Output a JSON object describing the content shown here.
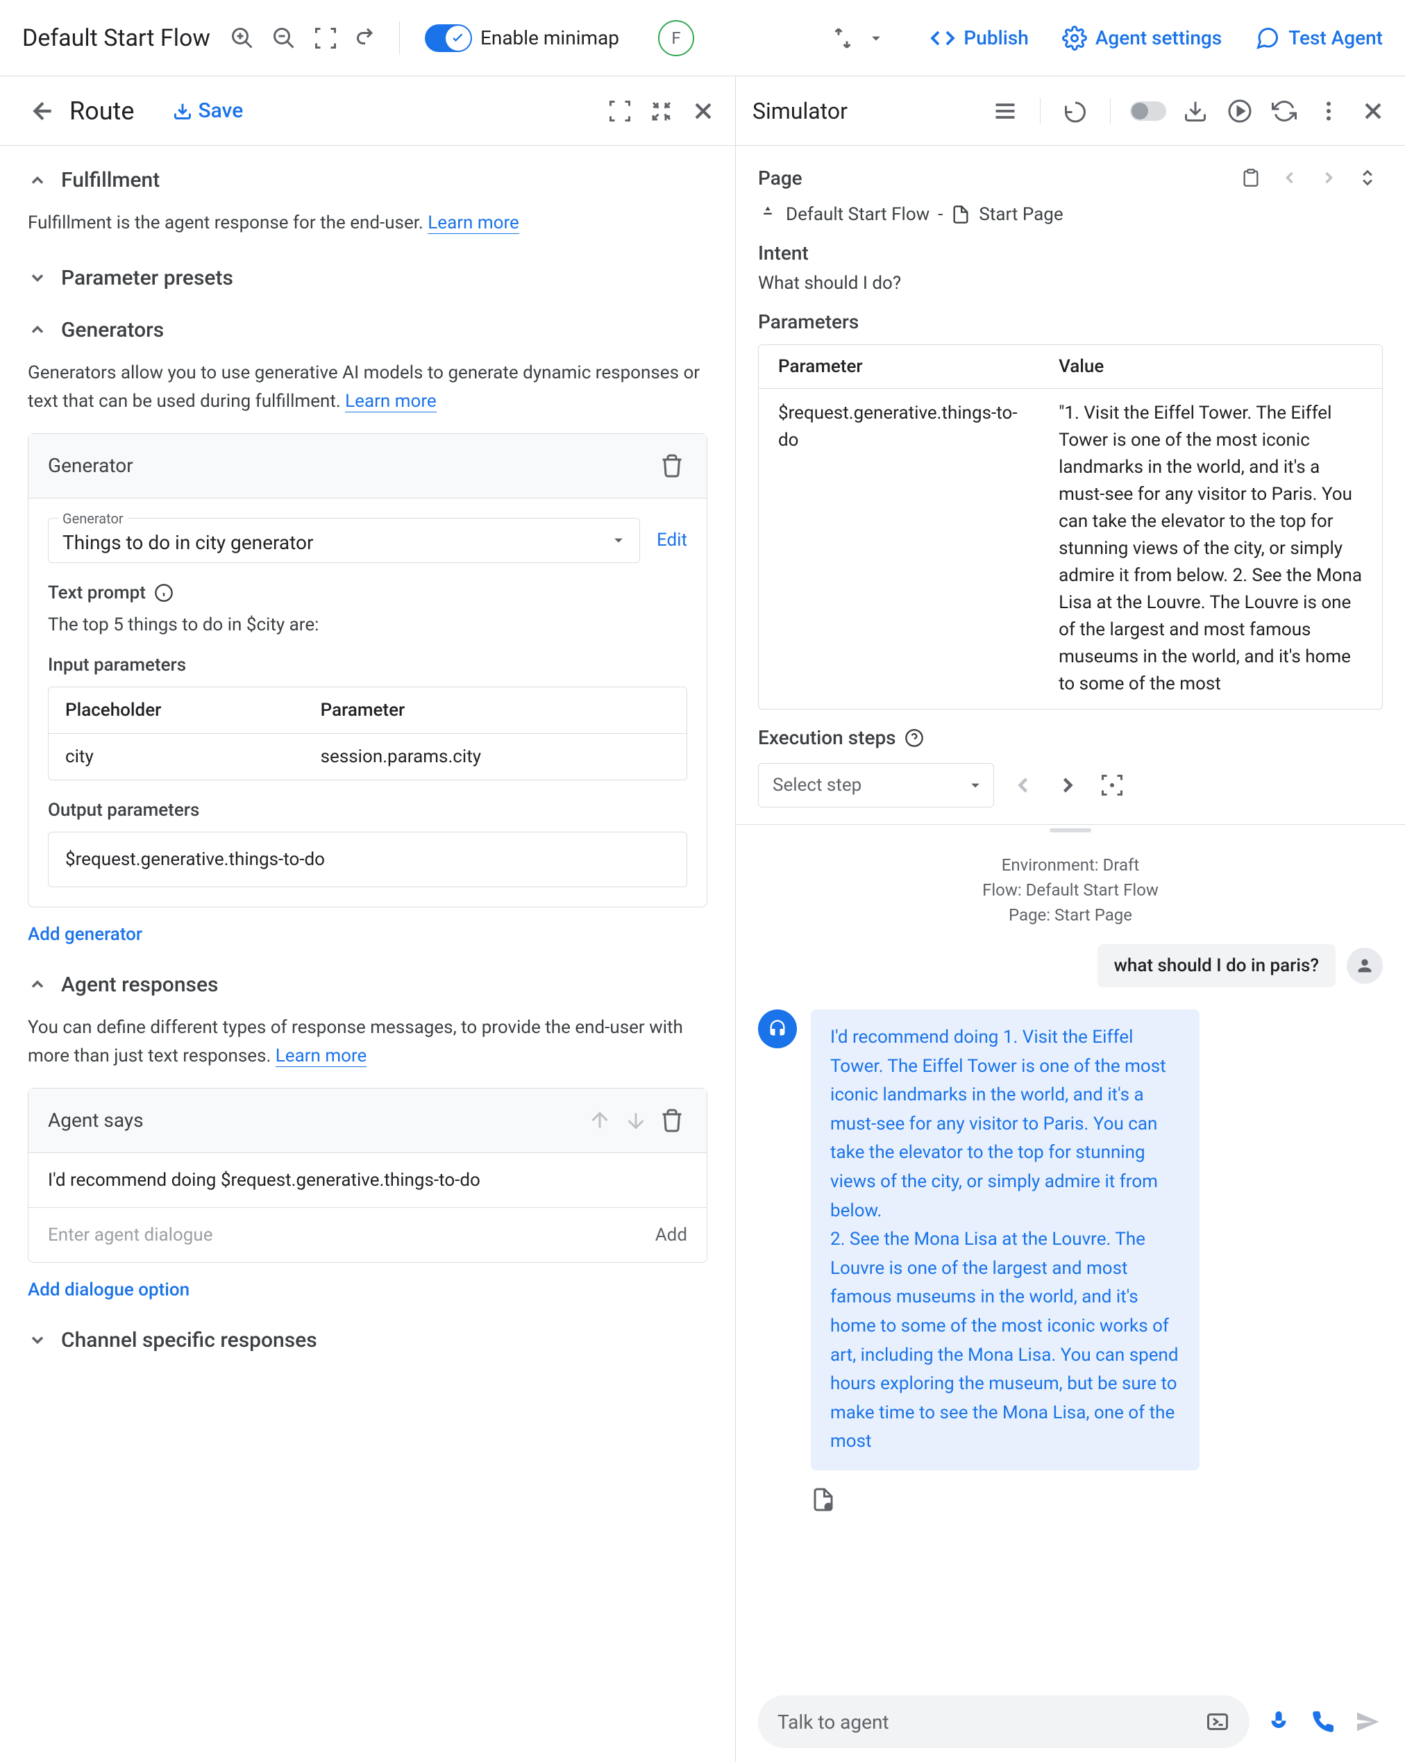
{
  "topbar": {
    "flow_title": "Default Start Flow",
    "minimap_label": "Enable minimap",
    "avatar_letter": "F",
    "publish": "Publish",
    "agent_settings": "Agent settings",
    "test_agent": "Test Agent"
  },
  "route_panel": {
    "title": "Route",
    "save": "Save",
    "fulfillment": {
      "title": "Fulfillment",
      "desc": "Fulfillment is the agent response for the end-user. ",
      "learn_more": "Learn more"
    },
    "param_presets": {
      "title": "Parameter presets"
    },
    "generators": {
      "title": "Generators",
      "desc": "Generators allow you to use generative AI models to generate dynamic responses or text that can be used during fulfillment. ",
      "learn_more": "Learn more",
      "card_title": "Generator",
      "select_label": "Generator",
      "select_value": "Things to do in city generator",
      "edit": "Edit",
      "prompt_label": "Text prompt",
      "prompt_value": "The top 5 things to do in $city are:",
      "inputs_label": "Input parameters",
      "inputs_cols": [
        "Placeholder",
        "Parameter"
      ],
      "inputs_rows": [
        [
          "city",
          "session.params.city"
        ]
      ],
      "outputs_label": "Output parameters",
      "outputs_value": "$request.generative.things-to-do",
      "add_generator": "Add generator"
    },
    "agent_responses": {
      "title": "Agent responses",
      "desc": "You can define different types of response messages, to provide the end-user with more than just text responses. ",
      "learn_more": "Learn more",
      "card_title": "Agent says",
      "value": "I'd recommend doing  $request.generative.things-to-do",
      "placeholder": "Enter agent dialogue",
      "add_btn": "Add",
      "add_dialogue": "Add dialogue option"
    },
    "channel_specific": {
      "title": "Channel specific responses"
    }
  },
  "simulator": {
    "title": "Simulator",
    "page_label": "Page",
    "breadcrumb_flow": "Default Start Flow",
    "breadcrumb_page": "Start Page",
    "intent_label": "Intent",
    "intent_value": "What should I do?",
    "params_label": "Parameters",
    "params_cols": [
      "Parameter",
      "Value"
    ],
    "params_rows": [
      [
        "$request.generative.things-to-do",
        "\"1. Visit the Eiffel Tower. The Eiffel Tower is one of the most iconic landmarks in the world, and it's a must-see for any visitor to Paris. You can take the elevator to the top for stunning views of the city, or simply admire it from below. 2. See the Mona Lisa at the Louvre. The Louvre is one of the largest and most famous museums in the world, and it's home to some of the most"
      ]
    ],
    "exec_label": "Execution steps",
    "step_placeholder": "Select step",
    "chat": {
      "env": "Environment: Draft",
      "flow": "Flow: Default Start Flow",
      "page": "Page: Start Page",
      "user_msg": "what should I do in paris?",
      "agent_msg": "I'd recommend doing 1. Visit the Eiffel Tower. The Eiffel Tower is one of the most iconic landmarks in the world, and it's a must-see for any visitor to Paris. You can take the elevator to the top for stunning views of the city, or simply admire it from below.\n2. See the Mona Lisa at the Louvre. The Louvre is one of the largest and most famous museums in the world, and it's home to some of the most iconic works of art, including the Mona Lisa. You can spend hours exploring the museum, but be sure to make time to see the Mona Lisa, one of the most"
    },
    "input_placeholder": "Talk to agent"
  }
}
